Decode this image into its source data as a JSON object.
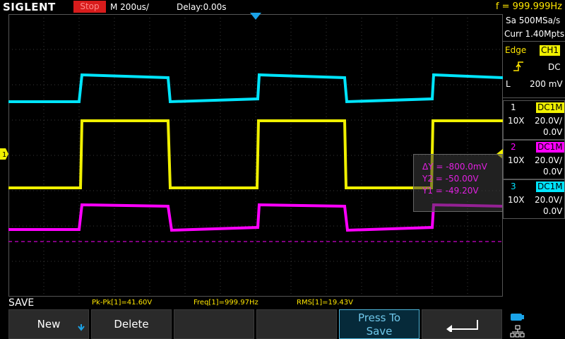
{
  "topbar": {
    "brand": "SIGLENT",
    "run_status": "Stop",
    "timebase": "M 200us/",
    "delay": "Delay:0.00s",
    "frequency": "f = 999.999Hz"
  },
  "acquisition": {
    "sample_rate": "Sa 500MSa/s",
    "memory": "Curr 1.40Mpts"
  },
  "trigger": {
    "type": "Edge",
    "source": "CH1",
    "coupling": "DC",
    "level_prefix": "L",
    "level": "200 mV"
  },
  "channels": [
    {
      "num": "1",
      "coupling": "DC1M",
      "probe": "10X",
      "scale": "20.0V/",
      "offset": "0.0V",
      "color": "#f0f000"
    },
    {
      "num": "2",
      "coupling": "DC1M",
      "probe": "10X",
      "scale": "20.0V/",
      "offset": "0.0V",
      "color": "#ff00ff"
    },
    {
      "num": "3",
      "coupling": "DC1M",
      "probe": "10X",
      "scale": "20.0V/",
      "offset": "0.0V",
      "color": "#00e5ff"
    }
  ],
  "cursor_measure": {
    "delta_y": "ΔY = -800.0mV",
    "y2": "Y2 = -50.00V",
    "y1": "Y1 = -49.20V"
  },
  "measurements": {
    "mode_label": "SAVE",
    "pkpk": "Pk-Pk[1]=41.60V",
    "freq": "Freq[1]=999.97Hz",
    "rms": "RMS[1]=19.43V"
  },
  "softkeys": {
    "new": "New",
    "delete": "Delete",
    "press_to": "Press To",
    "save": "Save"
  },
  "colors": {
    "ch1": "#f0f000",
    "ch2": "#ff00ff",
    "ch3": "#00e5ff",
    "stop": "#d81c1c",
    "accent": "#ffe600"
  }
}
